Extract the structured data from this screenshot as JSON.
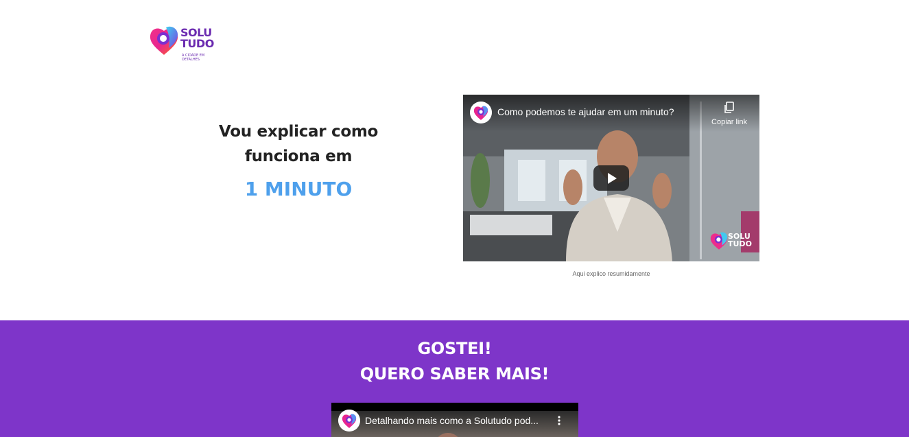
{
  "brand": {
    "name_line1": "SOLU",
    "name_line2": "TUDO",
    "tagline": "A CIDADE EM DETALHES"
  },
  "hero": {
    "line1": "Vou explicar como",
    "line2": "funciona em",
    "highlight": "1 MINUTO"
  },
  "video1": {
    "title": "Como podemos te ajudar em um minuto?",
    "copy_link_label": "Copiar link",
    "caption": "Aqui explico resumidamente",
    "watermark_line1": "SOLU",
    "watermark_line2": "TUDO"
  },
  "cta": {
    "line1": "GOSTEI!",
    "line2": "QUERO SABER MAIS!"
  },
  "video2": {
    "title": "Detalhando mais como a Solutudo pod..."
  },
  "colors": {
    "brand_purple": "#6b2bb0",
    "accent_blue": "#4ea0ec",
    "section_purple": "#7e35c9"
  }
}
